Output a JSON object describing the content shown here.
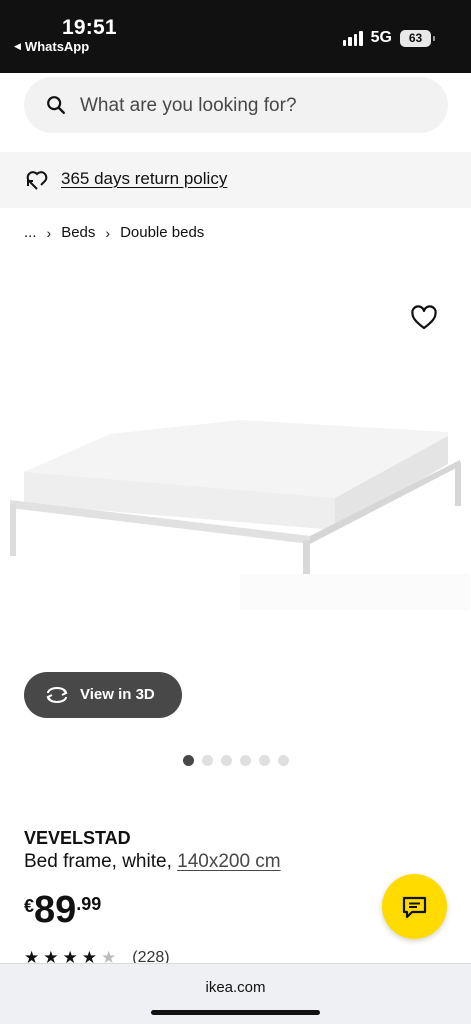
{
  "status_bar": {
    "time": "19:51",
    "back_app": "WhatsApp",
    "network": "5G",
    "battery": "63"
  },
  "search": {
    "placeholder": "What are you looking for?"
  },
  "policy": {
    "label": "365 days return policy"
  },
  "breadcrumb": {
    "items": [
      "...",
      "Beds",
      "Double beds"
    ]
  },
  "gallery": {
    "view_3d_label": "View in 3D",
    "image_count": 6,
    "active_index": 0
  },
  "product": {
    "name": "VEVELSTAD",
    "description": "Bed frame, white, ",
    "size": "140x200 cm",
    "price_currency": "€",
    "price_integer": "89",
    "price_decimal": ".99",
    "rating_stars": 4.5,
    "rating_count": "(228)"
  },
  "browser": {
    "url": "ikea.com"
  },
  "colors": {
    "accent_yellow": "#ffdb00",
    "dark_button": "#484848"
  }
}
